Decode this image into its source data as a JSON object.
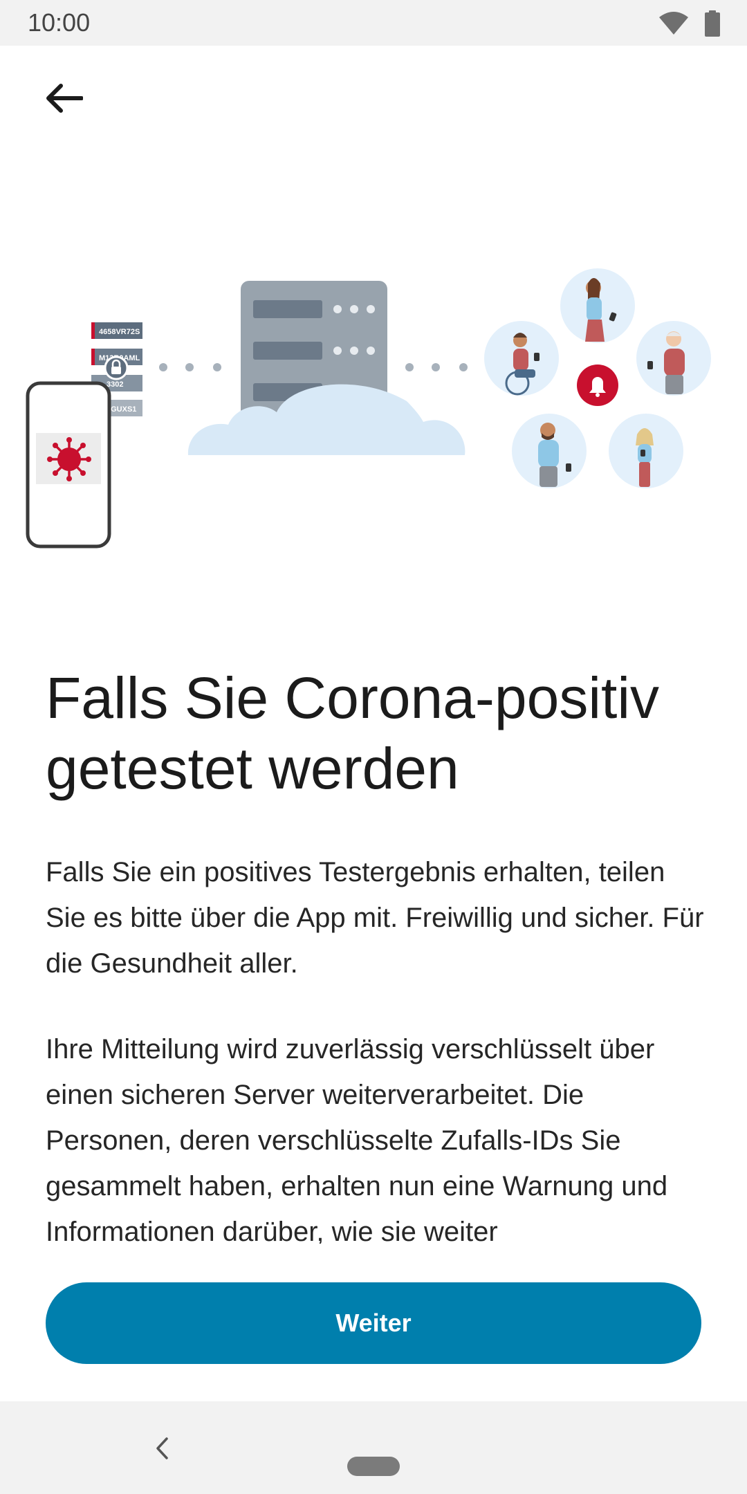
{
  "status_bar": {
    "time": "10:00",
    "icons": [
      "wifi-icon",
      "battery-icon"
    ]
  },
  "toolbar": {
    "back_icon": "arrow-back-icon"
  },
  "illustration": {
    "id_labels": [
      "4658VR72S",
      "M13R0AML",
      "…3302",
      "…4GUXS1"
    ],
    "icons": [
      "phone-icon",
      "virus-icon",
      "lock-icon",
      "server-icon",
      "cloud-icon",
      "bell-icon"
    ]
  },
  "content": {
    "title": "Falls Sie Corona-positiv getestet werden",
    "paragraph_1": "Falls Sie ein positives Testergebnis erhalten, teilen Sie es bitte über die App mit. Freiwillig und sicher. Für die Gesundheit aller.",
    "paragraph_2": "Ihre Mitteilung wird zuverlässig verschlüsselt über einen sicheren Server weiterverarbeitet. Die Personen, deren verschlüsselte Zufalls-IDs Sie gesammelt haben, erhalten nun eine Warnung und Informationen darüber, wie sie weiter"
  },
  "actions": {
    "next_label": "Weiter"
  },
  "colors": {
    "accent": "#007fad",
    "alert_red": "#c8102e",
    "server_gray": "#98a3ad",
    "cloud_blue": "#d8e9f7"
  }
}
